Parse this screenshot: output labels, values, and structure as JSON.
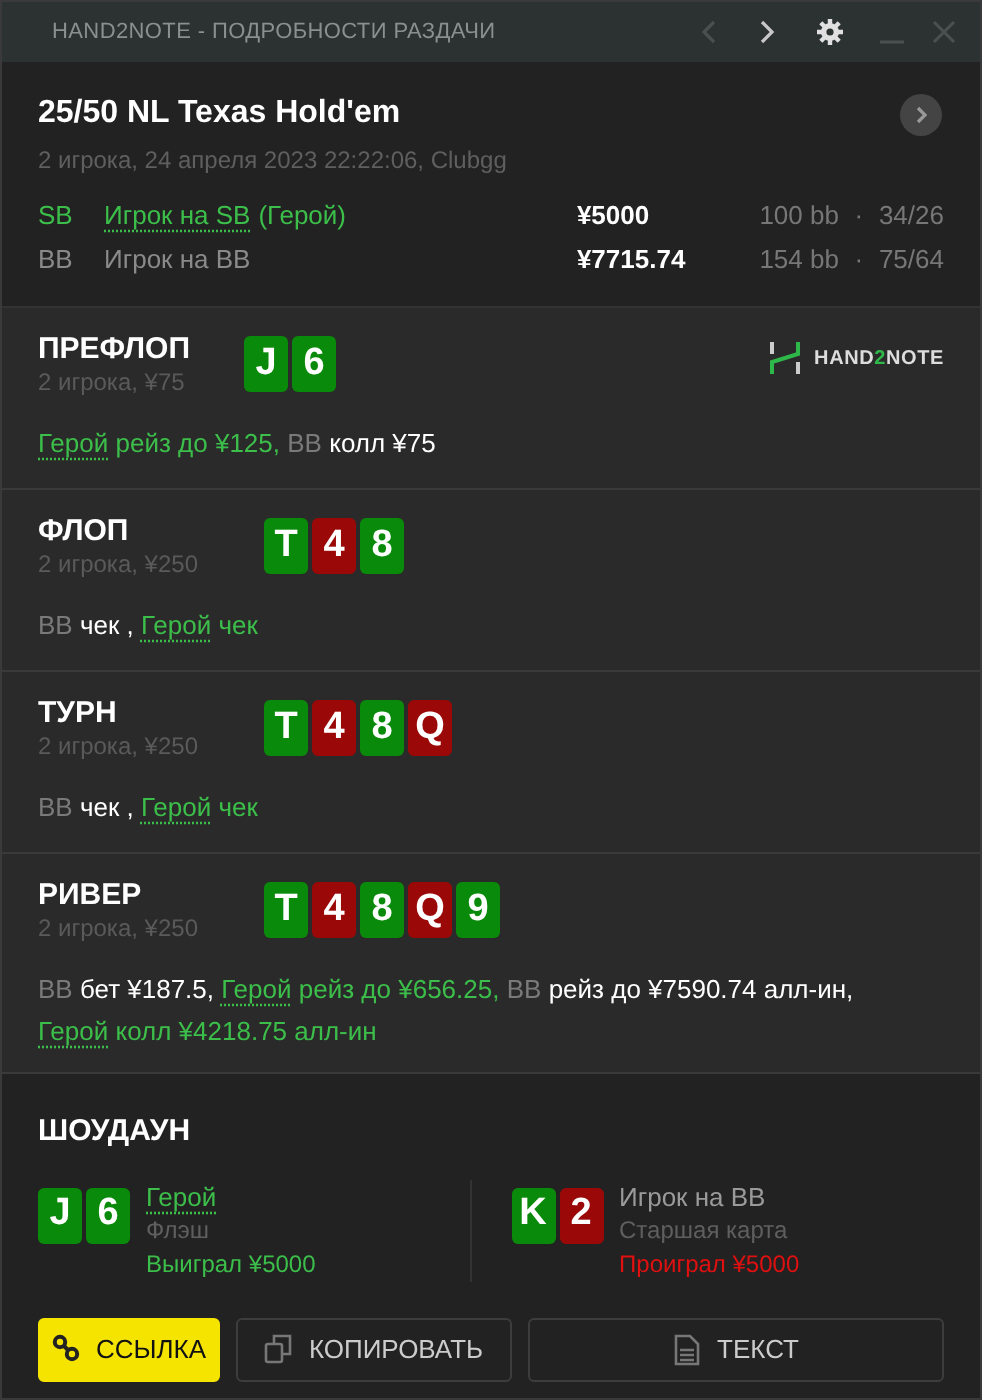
{
  "window": {
    "title": "HAND2NOTE - ПОДРОБНОСТИ РАЗДАЧИ",
    "back_disabled": true
  },
  "hand": {
    "title": "25/50 NL Texas Hold'em",
    "subtitle": "2 игрока, 24 апреля 2023 22:22:06, Clubgg",
    "players": [
      {
        "position": "SB",
        "name": "Игрок на SB",
        "hero_tag": "(Герой)",
        "hero": true,
        "stack": "¥5000",
        "bb": "100 bb",
        "separator": "·",
        "stats": "34/26"
      },
      {
        "position": "BB",
        "name": "Игрок на BB",
        "hero": false,
        "stack": "¥7715.74",
        "bb": "154 bb",
        "separator": "·",
        "stats": "75/64"
      }
    ]
  },
  "logo": {
    "parts": [
      "HAND",
      "2",
      "NOTE"
    ]
  },
  "streets": [
    {
      "name": "ПРЕФЛОП",
      "info": "2 игрока, ¥75",
      "cards": [
        {
          "rank": "J",
          "color": "#0a8a0a"
        },
        {
          "rank": "6",
          "color": "#0a8a0a"
        }
      ],
      "actions": [
        {
          "text": "Герой",
          "kind": "hero_name"
        },
        {
          "text": "рейз до ¥125,",
          "kind": "hero_action"
        },
        {
          "text": "BB",
          "kind": "player"
        },
        {
          "text": "колл ¥75",
          "kind": "action"
        }
      ]
    },
    {
      "name": "ФЛОП",
      "info": "2 игрока, ¥250",
      "cards": [
        {
          "rank": "T",
          "color": "#0a8a0a"
        },
        {
          "rank": "4",
          "color": "#9a0808"
        },
        {
          "rank": "8",
          "color": "#0a8a0a"
        }
      ],
      "actions": [
        {
          "text": "BB",
          "kind": "player"
        },
        {
          "text": "чек ,",
          "kind": "action"
        },
        {
          "text": "Герой",
          "kind": "hero_name"
        },
        {
          "text": "чек",
          "kind": "hero_action"
        }
      ]
    },
    {
      "name": "ТУРН",
      "info": "2 игрока, ¥250",
      "cards": [
        {
          "rank": "T",
          "color": "#0a8a0a"
        },
        {
          "rank": "4",
          "color": "#9a0808"
        },
        {
          "rank": "8",
          "color": "#0a8a0a"
        },
        {
          "rank": "Q",
          "color": "#9a0808"
        }
      ],
      "actions": [
        {
          "text": "BB",
          "kind": "player"
        },
        {
          "text": "чек ,",
          "kind": "action"
        },
        {
          "text": "Герой",
          "kind": "hero_name"
        },
        {
          "text": "чек",
          "kind": "hero_action"
        }
      ]
    },
    {
      "name": "РИВЕР",
      "info": "2 игрока, ¥250",
      "cards": [
        {
          "rank": "T",
          "color": "#0a8a0a"
        },
        {
          "rank": "4",
          "color": "#9a0808"
        },
        {
          "rank": "8",
          "color": "#0a8a0a"
        },
        {
          "rank": "Q",
          "color": "#9a0808"
        },
        {
          "rank": "9",
          "color": "#0a8a0a"
        }
      ],
      "actions": [
        {
          "text": "BB",
          "kind": "player"
        },
        {
          "text": "бет ¥187.5,",
          "kind": "action"
        },
        {
          "text": "Герой",
          "kind": "hero_name"
        },
        {
          "text": "рейз до ¥656.25,",
          "kind": "hero_action"
        },
        {
          "text": "BB",
          "kind": "player"
        },
        {
          "text": "рейз до ¥7590.74 алл-ин,",
          "kind": "action"
        },
        {
          "text": "Герой",
          "kind": "hero_name"
        },
        {
          "text": "колл ¥4218.75 алл-ин",
          "kind": "hero_action"
        }
      ]
    }
  ],
  "showdown": {
    "title": "ШОУДАУН",
    "players": [
      {
        "name": "Герой",
        "hero": true,
        "hand": "Флэш",
        "result": "Выиграл ¥5000",
        "won": true,
        "cards": [
          {
            "rank": "J",
            "color": "#0a8a0a"
          },
          {
            "rank": "6",
            "color": "#0a8a0a"
          }
        ]
      },
      {
        "name": "Игрок на BB",
        "hero": false,
        "hand": "Старшая карта",
        "result": "Проиграл ¥5000",
        "won": false,
        "cards": [
          {
            "rank": "K",
            "color": "#0a8a0a"
          },
          {
            "rank": "2",
            "color": "#9a0808"
          }
        ]
      }
    ]
  },
  "buttons": [
    {
      "label": "ССЫЛКА",
      "kind": "link"
    },
    {
      "label": "КОПИРОВАТЬ",
      "kind": "copy"
    },
    {
      "label": "ТЕКСТ",
      "kind": "text"
    }
  ]
}
